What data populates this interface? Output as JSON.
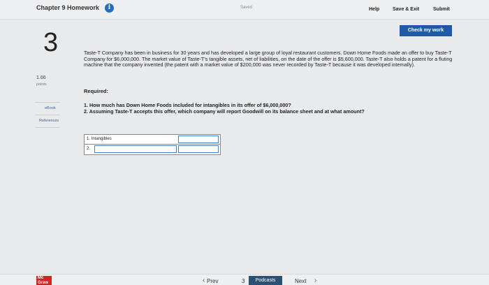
{
  "header": {
    "title": "Chapter 9 Homework",
    "info_icon": "i",
    "saved_text": "Saved",
    "help": "Help",
    "save_exit": "Save & Exit",
    "submit": "Submit"
  },
  "check_button": "Check my work",
  "question": {
    "number": "3",
    "points_value": "1.66",
    "points_label": "points"
  },
  "side_links": {
    "ebook": "eBook",
    "references": "References"
  },
  "problem_text": "Taste-T Company has been in business for 30 years and has developed a large group of loyal restaurant customers. Down Home Foods made an offer to buy Taste-T Company for $6,000,000. The market value of Taste-T's tangible assets, net of liabilities, on the date of the offer is $5,600,000. Taste-T also holds a patent for a fluting machine that the company invented (the patent with a market value of $200,000 was never recorded by Taste-T because it was developed internally).",
  "required_label": "Required:",
  "questions": [
    "1. How much has Down Home Foods included for intangibles in its offer of $6,000,000?",
    "2. Assuming Taste-T accepts this offer, which company will report Goodwill on its balance sheet and at what amount?"
  ],
  "answer_table": {
    "row1_label": "1. Intangibles",
    "row2_label": "2."
  },
  "footer": {
    "logo": "Mc Graw",
    "prev": "Prev",
    "page_current": "3",
    "podcasts": "Podcasts",
    "next": "Next"
  }
}
